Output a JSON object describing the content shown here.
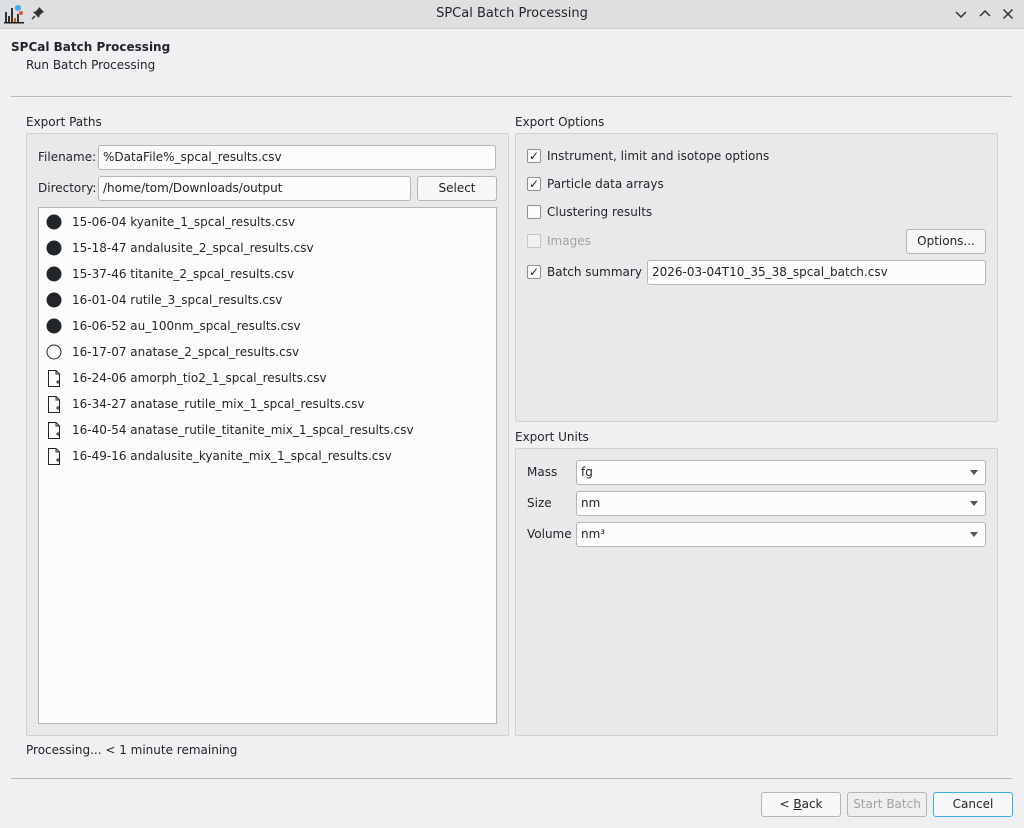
{
  "window": {
    "title": "SPCal Batch Processing"
  },
  "header": {
    "title": "SPCal Batch Processing",
    "subtitle": "Run Batch Processing"
  },
  "export_paths": {
    "group_label": "Export Paths",
    "filename_label": "Filename:",
    "filename_value": "%DataFile%_spcal_results.csv",
    "directory_label": "Directory:",
    "directory_value": "/home/tom/Downloads/output",
    "select_button": "Select",
    "files": [
      {
        "name": "15-06-04 kyanite_1_spcal_results.csv",
        "status": "done"
      },
      {
        "name": "15-18-47 andalusite_2_spcal_results.csv",
        "status": "done"
      },
      {
        "name": "15-37-46 titanite_2_spcal_results.csv",
        "status": "done"
      },
      {
        "name": "16-01-04 rutile_3_spcal_results.csv",
        "status": "done"
      },
      {
        "name": "16-06-52 au_100nm_spcal_results.csv",
        "status": "done"
      },
      {
        "name": "16-17-07 anatase_2_spcal_results.csv",
        "status": "processing"
      },
      {
        "name": "16-24-06 amorph_tio2_1_spcal_results.csv",
        "status": "pending"
      },
      {
        "name": "16-34-27 anatase_rutile_mix_1_spcal_results.csv",
        "status": "pending"
      },
      {
        "name": "16-40-54 anatase_rutile_titanite_mix_1_spcal_results.csv",
        "status": "pending"
      },
      {
        "name": "16-49-16 andalusite_kyanite_mix_1_spcal_results.csv",
        "status": "pending"
      }
    ]
  },
  "export_options": {
    "group_label": "Export Options",
    "instrument_label": "Instrument, limit and isotope options",
    "instrument_checked": true,
    "particle_label": "Particle data arrays",
    "particle_checked": true,
    "clustering_label": "Clustering results",
    "clustering_checked": false,
    "images_label": "Images",
    "images_checked": false,
    "images_options_button": "Options...",
    "summary_label": "Batch summary",
    "summary_checked": true,
    "summary_value": "2026-03-04T10_35_38_spcal_batch.csv"
  },
  "export_units": {
    "group_label": "Export Units",
    "mass_label": "Mass",
    "mass_value": "fg",
    "size_label": "Size",
    "size_value": "nm",
    "volume_label": "Volume",
    "volume_value": "nm³"
  },
  "status": {
    "text": "Processing... < 1 minute remaining"
  },
  "footer": {
    "back_prefix": "< ",
    "back_accel": "B",
    "back_rest": "ack",
    "start_button": "Start Batch",
    "cancel_button": "Cancel"
  }
}
